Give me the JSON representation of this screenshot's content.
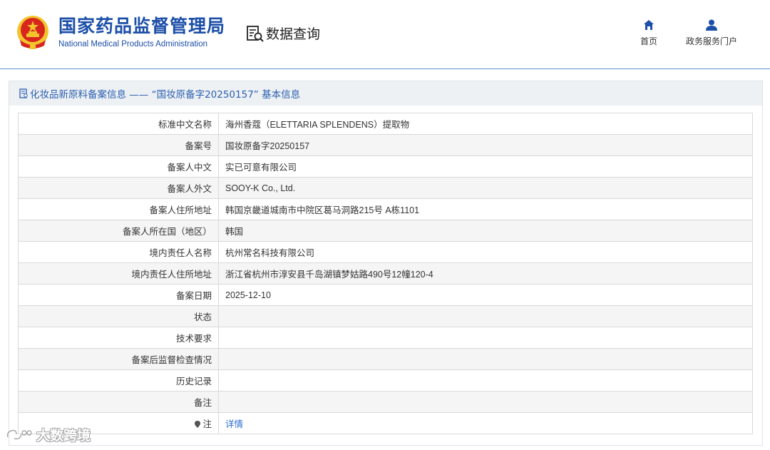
{
  "header": {
    "brand_cn": "国家药品监督管理局",
    "brand_en": "National Medical Products Administration",
    "query_label": "数据查询",
    "nav": [
      {
        "label": "首页",
        "icon": "home-icon"
      },
      {
        "label": "政务服务门户",
        "icon": "user-icon"
      }
    ]
  },
  "colors": {
    "brand_blue": "#1c4fa8",
    "link_blue": "#2a6bd6",
    "emblem_red": "#d8261e",
    "emblem_gold": "#f3c52d"
  },
  "panel": {
    "title": "化妆品新原料备案信息 —— “国妆原备字20250157” 基本信息"
  },
  "rows": [
    {
      "label": "标准中文名称",
      "value": "海州香蔻（ELETTARIA SPLENDENS）提取物"
    },
    {
      "label": "备案号",
      "value": "国妆原备字20250157"
    },
    {
      "label": "备案人中文",
      "value": "实已可意有限公司"
    },
    {
      "label": "备案人外文",
      "value": "SOOY-K Co., Ltd."
    },
    {
      "label": "备案人住所地址",
      "value": "韩国京畿道城南市中院区葛马洞路215号 A栋1101"
    },
    {
      "label": "备案人所在国（地区）",
      "value": "韩国"
    },
    {
      "label": "境内责任人名称",
      "value": "杭州常名科技有限公司"
    },
    {
      "label": "境内责任人住所地址",
      "value": "浙江省杭州市淳安县千岛湖镇梦姑路490号12幢120-4"
    },
    {
      "label": "备案日期",
      "value": "2025-12-10"
    },
    {
      "label": "状态",
      "value": ""
    },
    {
      "label": "技术要求",
      "value": ""
    },
    {
      "label": "备案后监督检查情况",
      "value": ""
    },
    {
      "label": "历史记录",
      "value": ""
    },
    {
      "label": "备注",
      "value": ""
    },
    {
      "label": "注",
      "value": "详情"
    }
  ],
  "watermark": {
    "text": "大数跨境"
  }
}
